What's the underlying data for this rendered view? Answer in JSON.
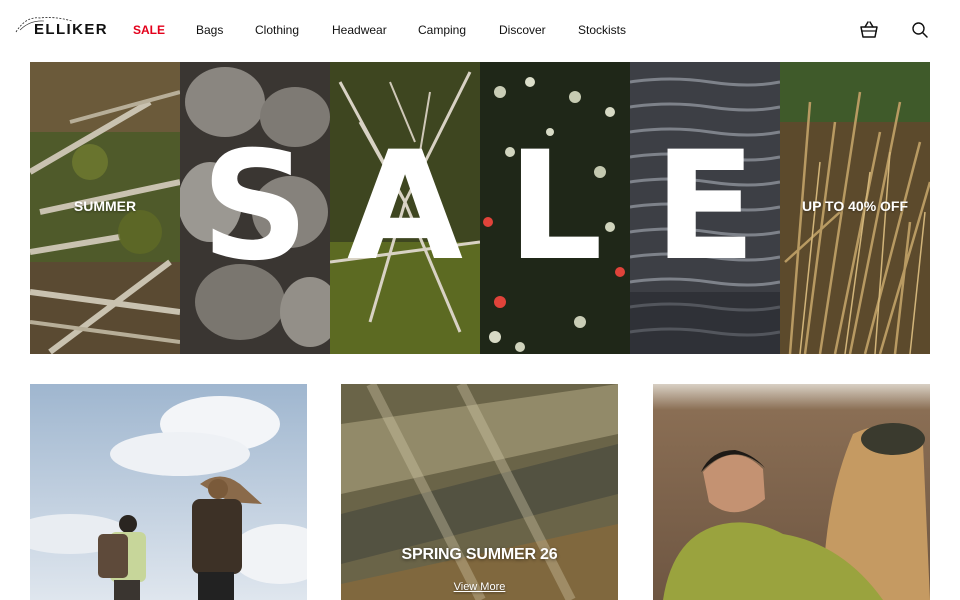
{
  "brand": {
    "name": "ELLIKER"
  },
  "nav": {
    "items": [
      {
        "label": "SALE",
        "highlight": true
      },
      {
        "label": "Bags"
      },
      {
        "label": "Clothing"
      },
      {
        "label": "Headwear"
      },
      {
        "label": "Camping"
      },
      {
        "label": "Discover"
      },
      {
        "label": "Stockists"
      }
    ],
    "basket_icon": "basket-icon",
    "search_icon": "search-icon"
  },
  "colors": {
    "sale_accent": "#e3001b",
    "text": "#111111",
    "background": "#ffffff"
  },
  "hero": {
    "left_text": "SUMMER",
    "letters": [
      "S",
      "A",
      "L",
      "E"
    ],
    "right_text": "UP TO 40% OFF"
  },
  "cards": [
    {
      "title": "",
      "link": ""
    },
    {
      "title": "SPRING SUMMER 26",
      "link": "View More"
    },
    {
      "title": "",
      "link": ""
    }
  ]
}
